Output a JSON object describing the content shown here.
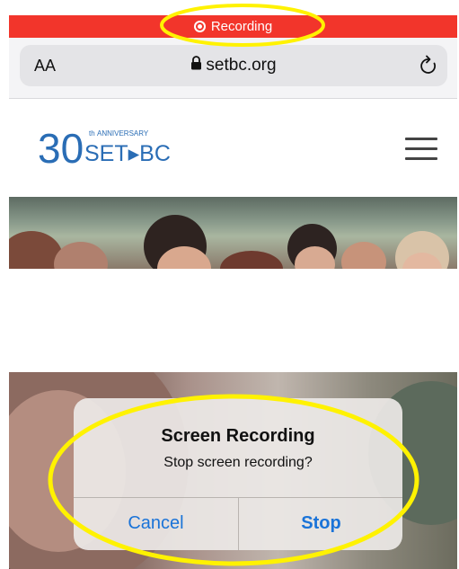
{
  "status_bar": {
    "recording_label": "Recording"
  },
  "browser": {
    "text_size_label": "AA",
    "url": "setbc.org"
  },
  "site": {
    "logo": {
      "number": "30",
      "superscript": "th",
      "anniversary": "ANNIVERSARY",
      "name": "SET▸BC"
    }
  },
  "dialog": {
    "title": "Screen Recording",
    "message": "Stop screen recording?",
    "cancel_label": "Cancel",
    "stop_label": "Stop"
  },
  "colors": {
    "recording_bar": "#f2352b",
    "highlight": "#fff200",
    "logo_blue": "#2a6db5",
    "button_blue": "#1a73d8"
  },
  "icons": [
    "record-icon",
    "lock-icon",
    "reload-icon",
    "hamburger-menu-icon"
  ]
}
